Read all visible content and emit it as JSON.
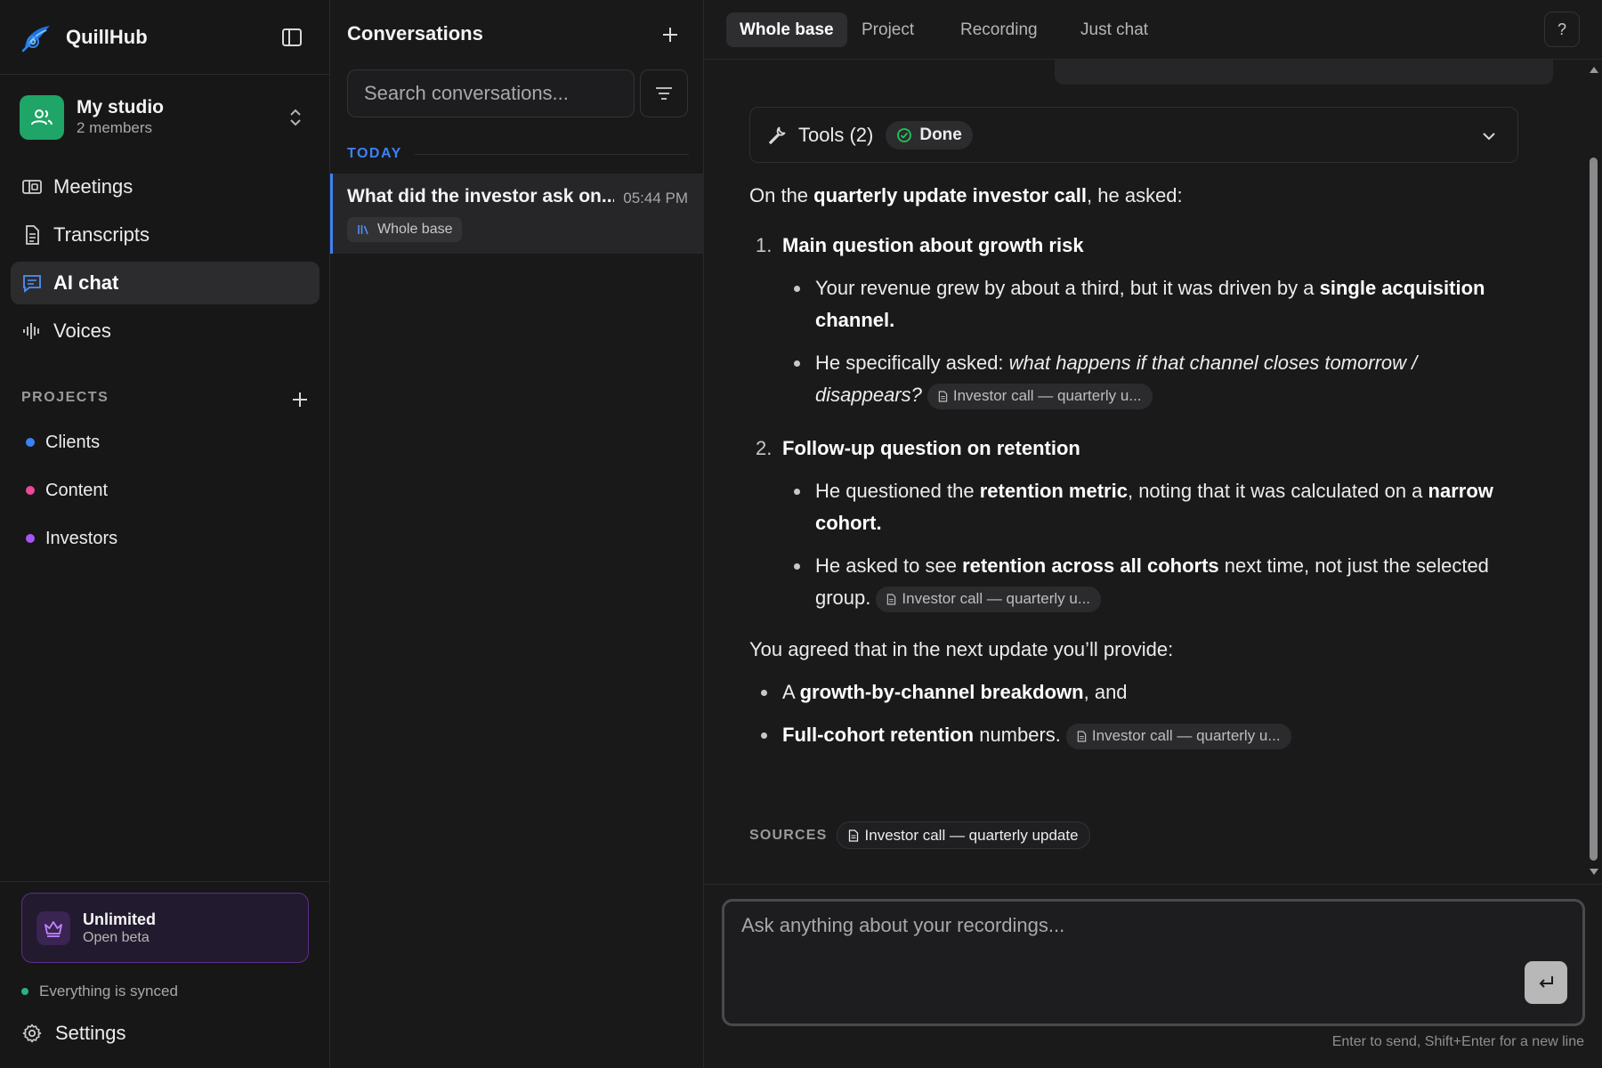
{
  "app": {
    "name": "QuillHub"
  },
  "workspace": {
    "name": "My studio",
    "members": "2 members"
  },
  "nav": [
    {
      "label": "Meetings",
      "icon": "meetings-icon",
      "active": false
    },
    {
      "label": "Transcripts",
      "icon": "document-icon",
      "active": false
    },
    {
      "label": "AI chat",
      "icon": "chat-icon",
      "active": true
    },
    {
      "label": "Voices",
      "icon": "waveform-icon",
      "active": false
    }
  ],
  "projects": {
    "heading": "PROJECTS",
    "items": [
      {
        "label": "Clients",
        "color": "#3b82f6"
      },
      {
        "label": "Content",
        "color": "#ec4899"
      },
      {
        "label": "Investors",
        "color": "#a855f7"
      }
    ]
  },
  "plan": {
    "name": "Unlimited",
    "sub": "Open beta"
  },
  "sync": {
    "status": "Everything is synced"
  },
  "settings": {
    "label": "Settings"
  },
  "conversations": {
    "title": "Conversations",
    "search_placeholder": "Search conversations...",
    "group": "TODAY",
    "items": [
      {
        "title": "What did the investor ask on...",
        "time": "05:44 PM",
        "tag": "Whole base"
      }
    ]
  },
  "tabs": [
    {
      "label": "Whole base",
      "active": true
    },
    {
      "label": "Project",
      "active": false
    },
    {
      "label": "Recording",
      "active": false
    },
    {
      "label": "Just chat",
      "active": false
    }
  ],
  "help": {
    "label": "?"
  },
  "tools": {
    "label": "Tools (2)",
    "status": "Done"
  },
  "answer": {
    "intro_pre": "On the ",
    "intro_bold": "quarterly update investor call",
    "intro_post": ", he asked:",
    "q1": {
      "num": "1.",
      "title": "Main question about growth risk",
      "b1_pre": "Your revenue grew by about a third, but it was driven by a ",
      "b1_bold": "single acquisition channel.",
      "b2_pre": "He specifically asked: ",
      "b2_italic": "what happens if that channel closes tomorrow / disappears?",
      "b2_cite": "Investor call — quarterly u..."
    },
    "q2": {
      "num": "2.",
      "title": "Follow-up question on retention",
      "b1_pre": "He questioned the ",
      "b1_bold": "retention metric",
      "b1_mid": ", noting that it was calculated on a ",
      "b1_bold2": "narrow cohort.",
      "b2_pre": "He asked to see ",
      "b2_bold": "retention across all cohorts",
      "b2_post": " next time, not just the selected group.",
      "b2_cite": "Investor call — quarterly u..."
    },
    "agree": "You agreed that in the next update you’ll provide:",
    "p1_pre": "A ",
    "p1_bold": "growth-by-channel breakdown",
    "p1_post": ", and",
    "p2_bold": "Full-cohort retention",
    "p2_post": " numbers.",
    "p2_cite": "Investor call — quarterly u..."
  },
  "sources": {
    "label": "SOURCES",
    "chip": "Investor call — quarterly update"
  },
  "composer": {
    "placeholder": "Ask anything about your recordings...",
    "hint": "Enter to send, Shift+Enter for a new line"
  }
}
